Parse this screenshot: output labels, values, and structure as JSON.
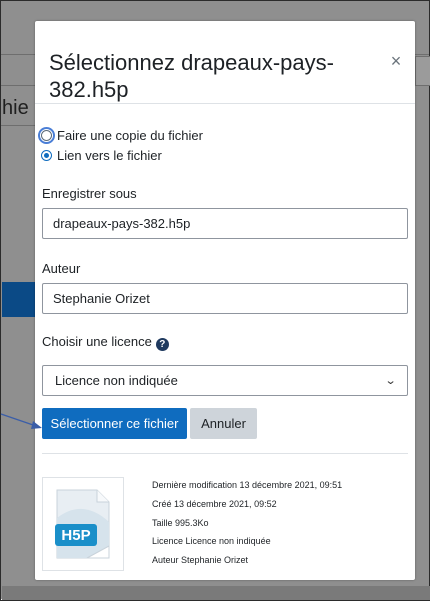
{
  "background": {
    "page_fragment": "hie"
  },
  "modal": {
    "title": "Sélectionnez drapeaux-pays-382.h5p",
    "close_symbol": "×",
    "options": {
      "copy_label": "Faire une copie du fichier",
      "link_label": "Lien vers le fichier",
      "selected": "link"
    },
    "save_as": {
      "label": "Enregistrer sous",
      "value": "drapeaux-pays-382.h5p"
    },
    "author": {
      "label": "Auteur",
      "value": "Stephanie Orizet"
    },
    "license": {
      "label": "Choisir une licence",
      "help_icon": "question-circle-icon",
      "selected": "Licence non indiquée"
    },
    "buttons": {
      "select_label": "Sélectionner ce fichier",
      "cancel_label": "Annuler"
    },
    "file_info": {
      "thumbnail_icon": "h5p-file-icon",
      "thumbnail_text": "H5P",
      "modified": "Dernière modification 13 décembre 2021, 09:51",
      "created": "Créé 13 décembre 2021, 09:52",
      "size": "Taille 995.3Ko",
      "licence": "Licence Licence non indiquée",
      "author": "Auteur Stephanie Orizet"
    }
  },
  "colors": {
    "primary": "#0f6cbf",
    "secondary": "#ced4da",
    "arrow": "#3b5ea8",
    "h5p_blue": "#1a8fc9"
  }
}
